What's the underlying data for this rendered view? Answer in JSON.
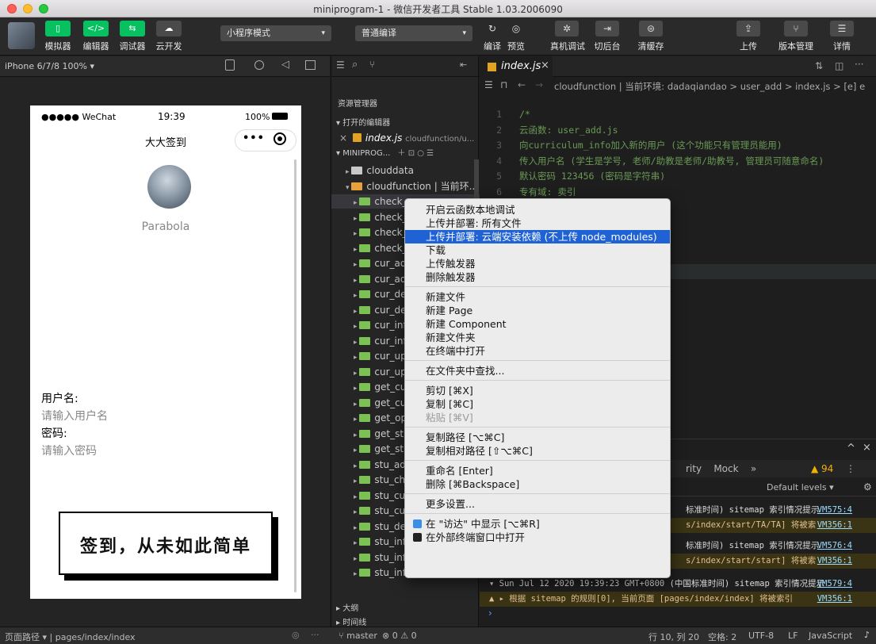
{
  "window": {
    "title": "miniprogram-1 - 微信开发者工具 Stable 1.03.2006090"
  },
  "toolbar": {
    "left_buttons": [
      {
        "label": "模拟器",
        "icon": "phone-icon",
        "color": "#07c160"
      },
      {
        "label": "编辑器",
        "icon": "code-icon",
        "color": "#07c160"
      },
      {
        "label": "调试器",
        "icon": "debug-icon",
        "color": "#07c160"
      },
      {
        "label": "云开发",
        "icon": "cloud-icon",
        "color": "#4a4a4a"
      }
    ],
    "mode_select": "小程序模式",
    "compile_select": "普通编译",
    "right_buttons": [
      {
        "label": "编译",
        "icon": "refresh-icon"
      },
      {
        "label": "预览",
        "icon": "eye-icon"
      },
      {
        "label": "真机调试",
        "icon": "bug-icon"
      },
      {
        "label": "切后台",
        "icon": "switch-icon"
      },
      {
        "label": "清缓存",
        "icon": "layers-icon"
      },
      {
        "label": "上传",
        "icon": "upload-icon"
      },
      {
        "label": "版本管理",
        "icon": "branch-icon"
      },
      {
        "label": "详情",
        "icon": "menu-icon"
      }
    ]
  },
  "simulator": {
    "device": "iPhone 6/7/8 100% ▾",
    "status_carrier": "●●●●● WeChat",
    "status_time": "19:39",
    "status_battery": "100%",
    "nav_title": "大大签到",
    "username_display": "Parabola",
    "form": {
      "username_label": "用户名:",
      "username_placeholder": "请输入用户名",
      "password_label": "密码:",
      "password_placeholder": "请输入密码"
    },
    "banner_text": "签到，从未如此简单"
  },
  "explorer": {
    "title": "资源管理器",
    "open_editors_label": "▾ 打开的编辑器",
    "open_editor_item": "index.js",
    "open_editor_path": "cloudfunction/u...",
    "project_label": "▾ MINIPROG...",
    "tree": [
      {
        "name": "clouddata",
        "indent": 1,
        "color": "#c8c8c8",
        "arrow": "▸"
      },
      {
        "name": "cloudfunction | 当前环...",
        "indent": 1,
        "color": "#e8a03c",
        "arrow": "▾"
      },
      {
        "name": "check_",
        "indent": 2,
        "color": "#7cc153",
        "arrow": "▸",
        "selected": true
      },
      {
        "name": "check_",
        "indent": 2,
        "color": "#7cc153",
        "arrow": "▸"
      },
      {
        "name": "check_",
        "indent": 2,
        "color": "#7cc153",
        "arrow": "▸"
      },
      {
        "name": "check_",
        "indent": 2,
        "color": "#7cc153",
        "arrow": "▸"
      },
      {
        "name": "cur_add",
        "indent": 2,
        "color": "#7cc153",
        "arrow": "▸"
      },
      {
        "name": "cur_add",
        "indent": 2,
        "color": "#7cc153",
        "arrow": "▸"
      },
      {
        "name": "cur_del",
        "indent": 2,
        "color": "#7cc153",
        "arrow": "▸"
      },
      {
        "name": "cur_del",
        "indent": 2,
        "color": "#7cc153",
        "arrow": "▸"
      },
      {
        "name": "cur_info",
        "indent": 2,
        "color": "#7cc153",
        "arrow": "▸"
      },
      {
        "name": "cur_info",
        "indent": 2,
        "color": "#7cc153",
        "arrow": "▸"
      },
      {
        "name": "cur_upd",
        "indent": 2,
        "color": "#7cc153",
        "arrow": "▸"
      },
      {
        "name": "cur_upd",
        "indent": 2,
        "color": "#7cc153",
        "arrow": "▸"
      },
      {
        "name": "get_cur",
        "indent": 2,
        "color": "#7cc153",
        "arrow": "▸"
      },
      {
        "name": "get_cur",
        "indent": 2,
        "color": "#7cc153",
        "arrow": "▸"
      },
      {
        "name": "get_op",
        "indent": 2,
        "color": "#7cc153",
        "arrow": "▸"
      },
      {
        "name": "get_stu",
        "indent": 2,
        "color": "#7cc153",
        "arrow": "▸"
      },
      {
        "name": "get_stu",
        "indent": 2,
        "color": "#7cc153",
        "arrow": "▸"
      },
      {
        "name": "stu_add",
        "indent": 2,
        "color": "#7cc153",
        "arrow": "▸"
      },
      {
        "name": "stu_che",
        "indent": 2,
        "color": "#7cc153",
        "arrow": "▸"
      },
      {
        "name": "stu_cur",
        "indent": 2,
        "color": "#7cc153",
        "arrow": "▸"
      },
      {
        "name": "stu_cur",
        "indent": 2,
        "color": "#7cc153",
        "arrow": "▸"
      },
      {
        "name": "stu_del",
        "indent": 2,
        "color": "#7cc153",
        "arrow": "▸"
      },
      {
        "name": "stu_info",
        "indent": 2,
        "color": "#7cc153",
        "arrow": "▸"
      },
      {
        "name": "stu_info_one",
        "indent": 2,
        "color": "#7cc153",
        "arrow": "▸"
      },
      {
        "name": "stu_info_part",
        "indent": 2,
        "color": "#7cc153",
        "arrow": "▸"
      }
    ],
    "outline_label": "▸ 大纲",
    "timeline_label": "▸ 时间线"
  },
  "editor": {
    "tab": "index.js",
    "breadcrumb": "cloudfunction | 当前环境: dadaqiandao > user_add > index.js > [e] e",
    "code": [
      {
        "n": "1",
        "text": "/*",
        "cls": "cm"
      },
      {
        "n": "2",
        "text": "云函数: user_add.js",
        "cls": "cm"
      },
      {
        "n": "3",
        "text": "向curriculum_info加入新的用户 (这个功能只有管理员能用)",
        "cls": "cm"
      },
      {
        "n": "4",
        "text": "传入用户名 (学生是学号, 老师/助教是老师/助教号, 管理员可随意命名)",
        "cls": "cm"
      },
      {
        "n": "5",
        "text": "默认密码 123456 (密码是字符串)",
        "cls": "cm"
      },
      {
        "n": "6",
        "text": "专有域: 卖引",
        "cls": "cm"
      },
      {
        "n": "7",
        "text": "                                   教务员(管理员, 最高权限))",
        "cls": "cm"
      },
      {
        "n": "8",
        "text": "",
        "cls": "cm"
      },
      {
        "n": "9",
        "text": "",
        "cls": "cm"
      },
      {
        "n": "10",
        "text": "                                   ver-sdk')",
        "cls": "st"
      }
    ],
    "code2": [
      {
        "n": "",
        "text": "                                   context) => {",
        "cls": "kw"
      },
      {
        "n": "",
        "text": "                                   'user_info').add({",
        "cls": "st"
      }
    ]
  },
  "console": {
    "tabs_visible": "rity    Mock    »",
    "warn_count": "▲ 94",
    "filter_levels": "Default levels ▾",
    "lines": [
      {
        "text": "标准时间) sitemap 索引情况提示",
        "vm": "VM575:4",
        "warn": false
      },
      {
        "text": "s/index/start/TA/TA] 将被索",
        "vm": "VM356:1",
        "warn": true
      },
      {
        "text": "标准时间) sitemap 索引情况提示",
        "vm": "VM576:4",
        "warn": false
      },
      {
        "text": "s/index/start/start] 将被索",
        "vm": "VM356:1",
        "warn": true
      },
      {
        "text": "▾ Sun Jul 12 2020 19:39:23 GMT+0800 (中国标准时间) sitemap 索引情况提示",
        "vm": "VM579:4",
        "warn": false
      },
      {
        "text": "  ▲ ▸ 根据 sitemap 的规则[0], 当前页面 [pages/index/index] 将被索引",
        "vm": "VM356:1",
        "warn": true
      }
    ]
  },
  "context_menu": {
    "groups": [
      [
        "开启云函数本地调试",
        "上传并部署: 所有文件",
        "上传并部署: 云端安装依赖 (不上传 node_modules)",
        "下载",
        "上传触发器",
        "删除触发器"
      ],
      [
        "新建文件",
        "新建 Page",
        "新建 Component",
        "新建文件夹",
        "在终端中打开"
      ],
      [
        "在文件夹中查找..."
      ],
      [
        "剪切 [⌘X]",
        "复制 [⌘C]",
        "粘贴 [⌘V]"
      ],
      [
        "复制路径 [⌥⌘C]",
        "复制相对路径 [⇧⌥⌘C]"
      ],
      [
        "重命名 [Enter]",
        "删除 [⌘Backspace]"
      ],
      [
        "更多设置..."
      ],
      [
        "在 \"访达\" 中显示 [⌥⌘R]",
        "在外部终端窗口中打开"
      ]
    ],
    "selected": "上传并部署: 云端安装依赖 (不上传 node_modules)",
    "disabled": "粘贴 [⌘V]"
  },
  "statusbar": {
    "page_path": "页面路径 ▾ | pages/index/index",
    "branch": "master",
    "errors": "⊗ 0 ⚠ 0",
    "cursor": "行 10, 列 20",
    "indent": "空格: 2",
    "encoding": "UTF-8",
    "eol": "LF",
    "language": "JavaScript"
  },
  "colors": {
    "accent_green": "#07c160",
    "menu_highlight": "#1f62d4",
    "js_icon": "#e2a322"
  }
}
